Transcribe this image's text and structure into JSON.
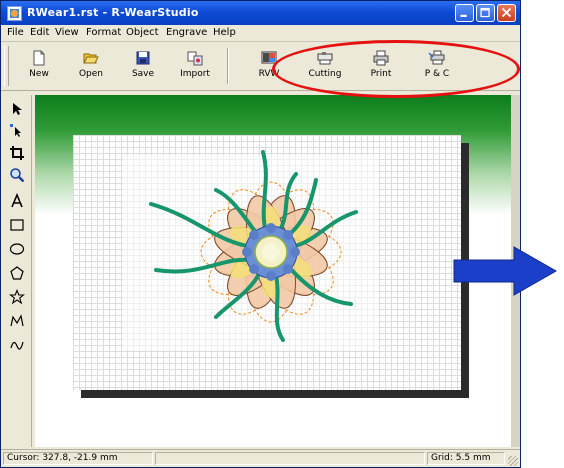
{
  "window": {
    "title": "RWear1.rst - R-WearStudio",
    "controls": [
      "minimize-icon",
      "maximize-icon",
      "close-icon"
    ]
  },
  "menu": [
    "File",
    "Edit",
    "View",
    "Format",
    "Object",
    "Engrave",
    "Help"
  ],
  "toolbar": {
    "new_label": "New",
    "open_label": "Open",
    "save_label": "Save",
    "import_label": "Import",
    "rvw_label": "RVW",
    "cutting_label": "Cutting",
    "print_label": "Print",
    "pc_label": "P & C",
    "highlight_color": "#e51010"
  },
  "tools": [
    "select-arrow-icon",
    "node-edit-icon",
    "crop-icon",
    "zoom-icon",
    "text-icon",
    "rectangle-icon",
    "ellipse-icon",
    "polygon-icon",
    "star-icon",
    "polyline-icon",
    "freehand-icon"
  ],
  "status": {
    "cursor": "Cursor: 327.8, -21.9 mm",
    "grid": "Grid: 5.5 mm"
  },
  "colors": {
    "titlebar": "#0d4bd6",
    "canvas_gradient_top": "#0d7d1c",
    "arrow": "#1b3fc9",
    "stem": "#17956b",
    "petal": "#f2c9a6",
    "cut_line": "#f08a1c"
  }
}
